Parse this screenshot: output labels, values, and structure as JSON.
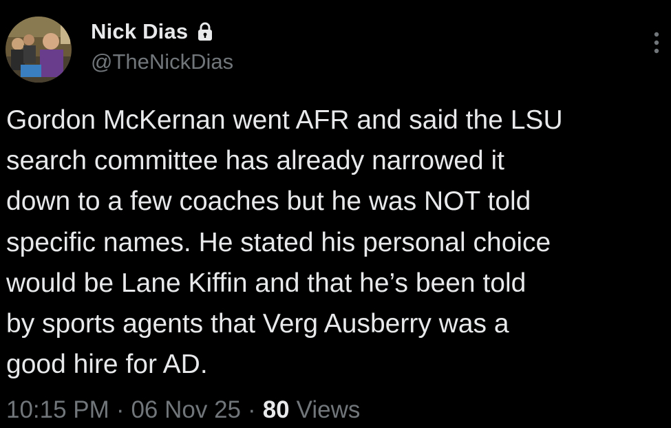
{
  "author": {
    "display_name": "Nick Dias",
    "handle": "@TheNickDias",
    "protected_icon": "lock-icon",
    "avatar_icon": "profile-photo"
  },
  "tweet": {
    "text": "Gordon McKernan went AFR and said the LSU\nsearch committee has already narrowed it\ndown to a few coaches but he was NOT told\nspecific names. He stated his personal choice\nwould be Lane Kiffin and that he’s been told\nby sports agents that Verg Ausberry was a\ngood hire for AD."
  },
  "meta": {
    "time": "10:15 PM",
    "separator": "·",
    "date": "06 Nov 25",
    "views_count": "80",
    "views_label": "Views"
  },
  "menu": {
    "icon": "more-vertical-icon"
  },
  "colors": {
    "background": "#000000",
    "primary_text": "#e7e9ea",
    "secondary_text": "#71767b"
  }
}
